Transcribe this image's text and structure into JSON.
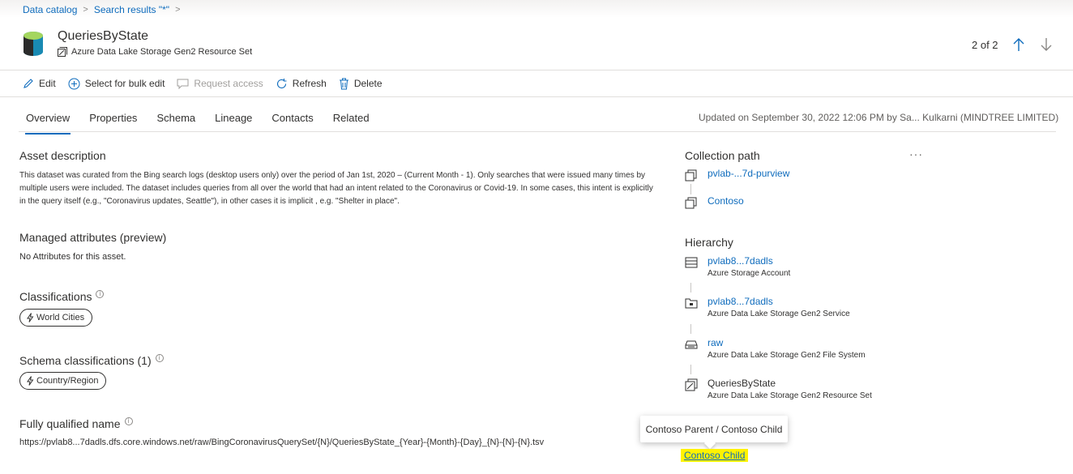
{
  "breadcrumb": {
    "items": [
      "Data catalog",
      "Search results \"*\""
    ]
  },
  "asset": {
    "title": "QueriesByState",
    "type": "Azure Data Lake Storage Gen2 Resource Set"
  },
  "pager": {
    "text": "2 of 2"
  },
  "toolbar": {
    "edit": "Edit",
    "bulk_edit": "Select for bulk edit",
    "request_access": "Request access",
    "refresh": "Refresh",
    "delete": "Delete"
  },
  "tabs": [
    {
      "label": "Overview",
      "active": true
    },
    {
      "label": "Properties",
      "active": false
    },
    {
      "label": "Schema",
      "active": false
    },
    {
      "label": "Lineage",
      "active": false
    },
    {
      "label": "Contacts",
      "active": false
    },
    {
      "label": "Related",
      "active": false
    }
  ],
  "updated": "Updated on September 30, 2022 12:06 PM by Sa... Kulkarni (MINDTREE LIMITED)",
  "asset_description": {
    "title": "Asset description",
    "text": "This dataset was curated from the Bing search logs (desktop users only) over the period of Jan 1st, 2020 – (Current Month - 1). Only searches that were issued many times by multiple users were included. The dataset includes queries from all over the world that had an intent related to the Coronavirus or Covid-19. In some cases, this intent is explicitly in the query itself (e.g., \"Coronavirus updates, Seattle\"), in other cases it is implicit , e.g. \"Shelter in place\"."
  },
  "managed_attributes": {
    "title": "Managed attributes (preview)",
    "text": "No Attributes for this asset."
  },
  "classifications": {
    "title": "Classifications",
    "pill": "World Cities"
  },
  "schema_classifications": {
    "title": "Schema classifications (1)",
    "pill": "Country/Region"
  },
  "fully_qualified_name": {
    "title": "Fully qualified name",
    "value": "https://pvlab8...7dadls.dfs.core.windows.net/raw/BingCoronavirusQuerySet/{N}/QueriesByState_{Year}-{Month}-{Day}_{N}-{N}-{N}.tsv"
  },
  "collection_path": {
    "title": "Collection path",
    "more": "···",
    "items": [
      "pvlab-...7d-purview",
      "Contoso"
    ]
  },
  "hierarchy": {
    "title": "Hierarchy",
    "items": [
      {
        "name": "pvlab8...7dadls",
        "type": "Azure Storage Account",
        "link": true
      },
      {
        "name": "pvlab8...7dadls",
        "type": "Azure Data Lake Storage Gen2 Service",
        "link": true
      },
      {
        "name": "raw",
        "type": "Azure Data Lake Storage Gen2 File System",
        "link": true
      },
      {
        "name": "QueriesByState",
        "type": "Azure Data Lake Storage Gen2 Resource Set",
        "link": false
      }
    ]
  },
  "tooltip": {
    "text": "Contoso Parent / Contoso Child"
  },
  "highlighted_link": {
    "text": "Contoso Child"
  },
  "colors": {
    "accent": "#0f6cbd",
    "highlight": "#fff200",
    "text": "#323130"
  }
}
